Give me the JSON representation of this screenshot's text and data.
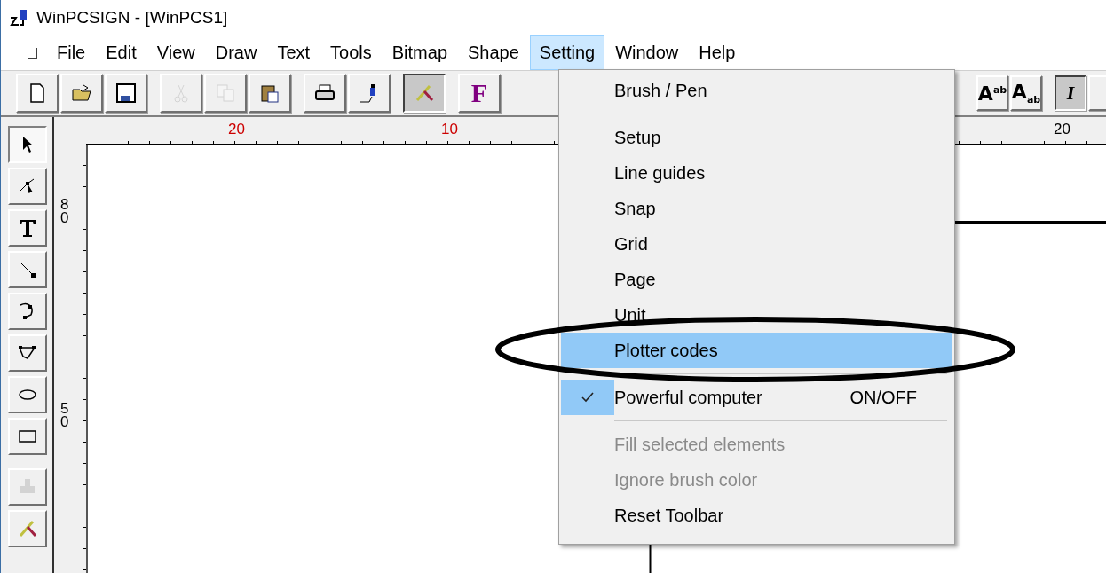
{
  "window": {
    "title": "WinPCSIGN - [WinPCS1]"
  },
  "menu_bar": [
    {
      "label": "File",
      "selected": false
    },
    {
      "label": "Edit",
      "selected": false
    },
    {
      "label": "View",
      "selected": false
    },
    {
      "label": "Draw",
      "selected": false
    },
    {
      "label": "Text",
      "selected": false
    },
    {
      "label": "Tools",
      "selected": false
    },
    {
      "label": "Bitmap",
      "selected": false
    },
    {
      "label": "Shape",
      "selected": false
    },
    {
      "label": "Setting",
      "selected": true
    },
    {
      "label": "Window",
      "selected": false
    },
    {
      "label": "Help",
      "selected": false
    }
  ],
  "toolbar": [
    [
      {
        "kind": "new",
        "disabled": false,
        "pressed": false
      },
      {
        "kind": "open",
        "disabled": false,
        "pressed": false
      },
      {
        "kind": "save",
        "disabled": false,
        "pressed": false
      }
    ],
    [
      {
        "kind": "cut",
        "disabled": true,
        "pressed": false
      },
      {
        "kind": "copy",
        "disabled": true,
        "pressed": false
      },
      {
        "kind": "paste",
        "disabled": false,
        "pressed": false
      }
    ],
    [
      {
        "kind": "print",
        "disabled": false,
        "pressed": false
      },
      {
        "kind": "plotter",
        "disabled": false,
        "pressed": false
      }
    ],
    [
      {
        "kind": "knife",
        "disabled": false,
        "pressed": true
      }
    ],
    [
      {
        "kind": "text",
        "label": "F",
        "disabled": false,
        "pressed": false
      }
    ]
  ],
  "toolbar_right": [
    [
      {
        "kind": "text",
        "label": "A$^{ab}$",
        "disabled": false,
        "pressed": false
      },
      {
        "kind": "text",
        "label": "A$_{ab}$",
        "disabled": false,
        "pressed": false
      }
    ],
    [
      {
        "kind": "text",
        "label": "I",
        "disabled": false,
        "pressed": true
      },
      {
        "kind": "blank",
        "pressed": false
      }
    ]
  ],
  "toolbox": [
    {
      "kind": "select",
      "selected": true,
      "disabled": false
    },
    {
      "kind": "node",
      "selected": false,
      "disabled": false
    },
    {
      "kind": "text",
      "selected": false,
      "disabled": false
    },
    {
      "kind": "line",
      "selected": false,
      "disabled": false
    },
    {
      "kind": "arc",
      "selected": false,
      "disabled": false
    },
    {
      "kind": "polygon",
      "selected": false,
      "disabled": false
    },
    {
      "kind": "ellipse",
      "selected": false,
      "disabled": false
    },
    {
      "kind": "rect",
      "selected": false,
      "disabled": false
    },
    {
      "kind": "stamp",
      "selected": false,
      "disabled": true
    },
    {
      "kind": "knife",
      "selected": false,
      "disabled": false
    }
  ],
  "horizontal_ruler": [
    {
      "label": "20",
      "color": "#cc0000"
    },
    {
      "label": "10",
      "color": "#cc0000"
    },
    {
      "label": "20",
      "color": "#000000"
    }
  ],
  "vertical_ruler": [
    "80",
    "50"
  ],
  "dropdown": [
    {
      "kind": "item",
      "label": "Brush / Pen",
      "selected": false,
      "disabled": false,
      "checked": false
    },
    {
      "kind": "separator"
    },
    {
      "kind": "item",
      "label": "Setup",
      "selected": false,
      "disabled": false,
      "checked": false
    },
    {
      "kind": "item",
      "label": "Line guides",
      "selected": false,
      "disabled": false,
      "checked": false
    },
    {
      "kind": "item",
      "label": "Snap",
      "selected": false,
      "disabled": false,
      "checked": false
    },
    {
      "kind": "item",
      "label": "Grid",
      "selected": false,
      "disabled": false,
      "checked": false
    },
    {
      "kind": "item",
      "label": "Page",
      "selected": false,
      "disabled": false,
      "checked": false
    },
    {
      "kind": "item",
      "label": "Unit",
      "selected": false,
      "disabled": false,
      "checked": false
    },
    {
      "kind": "item",
      "label": "Plotter codes",
      "selected": true,
      "disabled": false,
      "checked": false
    },
    {
      "kind": "separator"
    },
    {
      "kind": "item",
      "label": "Powerful computer",
      "shortcut": "ON/OFF",
      "selected": false,
      "disabled": false,
      "checked": true
    },
    {
      "kind": "separator"
    },
    {
      "kind": "item",
      "label": "Fill selected elements",
      "selected": false,
      "disabled": true,
      "checked": false
    },
    {
      "kind": "item",
      "label": "Ignore brush color",
      "selected": false,
      "disabled": true,
      "checked": false
    },
    {
      "kind": "item",
      "label": "Reset Toolbar",
      "selected": false,
      "disabled": false,
      "checked": false
    }
  ],
  "annotation": {
    "kind": "ellipse"
  }
}
